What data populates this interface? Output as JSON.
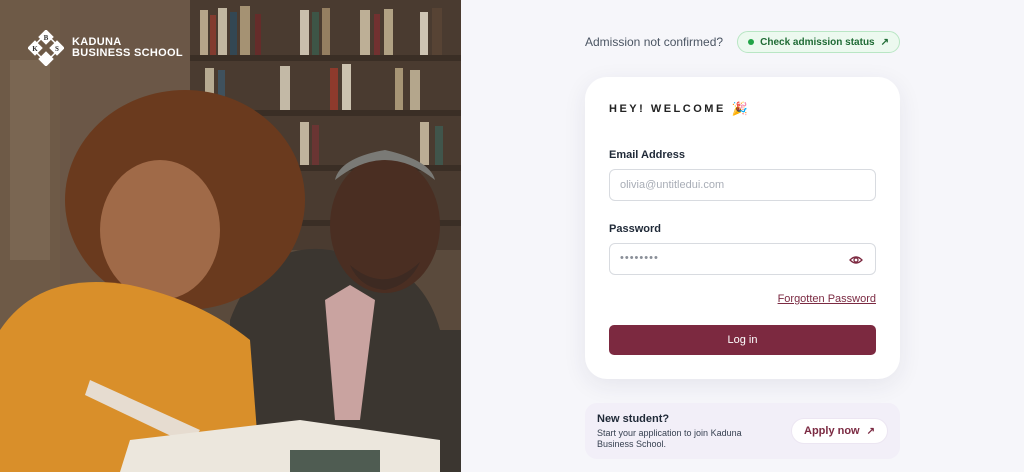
{
  "brand": {
    "name_line1": "KADUNA",
    "name_line2": "BUSINESS SCHOOL",
    "mark_letters": [
      "B",
      "K",
      "S"
    ]
  },
  "status": {
    "question": "Admission not confirmed?",
    "button_label": "Check admission status",
    "arrow": "↗"
  },
  "login": {
    "greeting": "HEY! WELCOME",
    "party_icon": "🎉",
    "email_label": "Email Address",
    "email_placeholder": "olivia@untitledui.com",
    "password_label": "Password",
    "password_value": "••••••••",
    "forgot_label": "Forgotten Password",
    "login_label": "Log in"
  },
  "new_student": {
    "title": "New student?",
    "description": "Start your application to join Kaduna Business School.",
    "apply_label": "Apply now",
    "arrow": "↗"
  },
  "colors": {
    "primary": "#7c2940",
    "success": "#22a447",
    "background": "#f6f6fa"
  }
}
